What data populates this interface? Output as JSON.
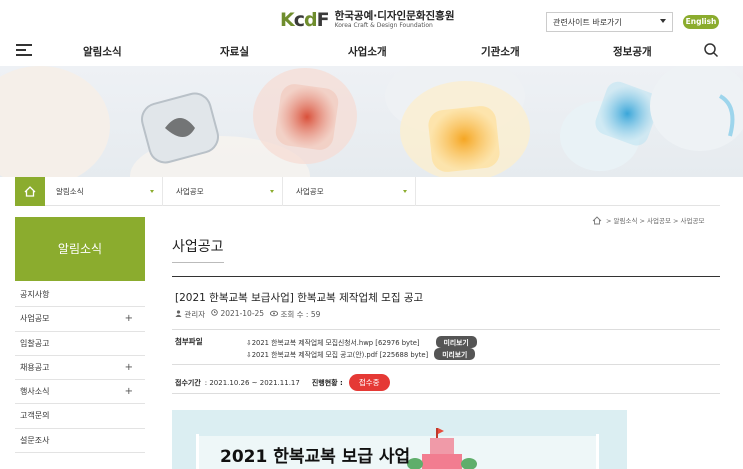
{
  "header": {
    "logo_mark": "KCDF",
    "logo_ko": "한국공예·디자인문화진흥원",
    "logo_en": "Korea Craft & Design Foundation",
    "related_sites": "관련사이트 바로가기",
    "english": "English"
  },
  "gnb": [
    "알림소식",
    "자료실",
    "사업소개",
    "기관소개",
    "정보공개"
  ],
  "subnav": [
    "알림소식",
    "사업공모",
    "사업공모"
  ],
  "sidebar": {
    "title": "알림소식",
    "items": [
      {
        "label": "공지사항",
        "plus": ""
      },
      {
        "label": "사업공모",
        "plus": "+"
      },
      {
        "label": "입찰공고",
        "plus": ""
      },
      {
        "label": "채용공고",
        "plus": "+"
      },
      {
        "label": "행사소식",
        "plus": "+"
      },
      {
        "label": "고객문의",
        "plus": ""
      },
      {
        "label": "설문조사",
        "plus": ""
      }
    ]
  },
  "breadcrumb": "> 알림소식 > 사업공모 > 사업공모",
  "page_title": "사업공고",
  "post": {
    "title": "[2021 한복교복 보급사업] 한복교복 제작업체 모집 공고",
    "author": "관리자",
    "date": "2021-10-25",
    "views_label": "조회 수 : 59",
    "attach_label": "첨부파일",
    "files": [
      {
        "name": "2021 한복교복 제작업체 모집신청서.hwp",
        "size": "[62976 byte]",
        "preview": "미리보기"
      },
      {
        "name": "2021 한복교복 제작업체 모집 공고(안).pdf",
        "size": "[225688 byte]",
        "preview": "미리보기"
      }
    ],
    "period_label": "접수기간",
    "period": ": 2021.10.26 ~ 2021.11.17",
    "progress_label": "진행현황 :",
    "status": "접수중",
    "poster_title": "2021 한복교복 보급 사업"
  },
  "colors": {
    "brand_green": "#8bac2e",
    "status_red": "#e53935"
  }
}
